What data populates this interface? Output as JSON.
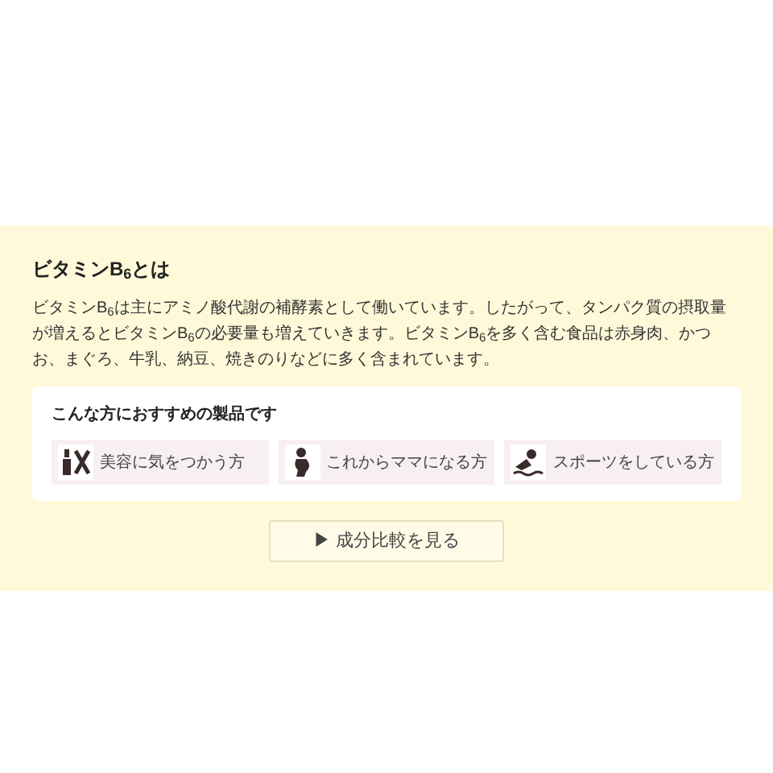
{
  "section": {
    "title": "ビタミンB$_{6}$とは",
    "body": "ビタミンB$_{6}$は主にアミノ酸代謝の補酵素として働いています。したがって、タンパク質の摂取量が増えるとビタミンB$_{6}$の必要量も増えていきます。ビタミンB$_{6}$を多く含む食品は赤身肉、かつお、まぐろ、牛乳、納豆、焼きのりなどに多く含まれています。"
  },
  "recommend": {
    "title": "こんな方におすすめの製品です",
    "items": [
      {
        "kind": "beauty",
        "label": "美容に気をつかう方"
      },
      {
        "kind": "mother",
        "label": "これからママになる方"
      },
      {
        "kind": "sports",
        "label": "スポーツをしている方"
      }
    ]
  },
  "button": {
    "arrow": "▶",
    "label": "成分比較を見る"
  }
}
